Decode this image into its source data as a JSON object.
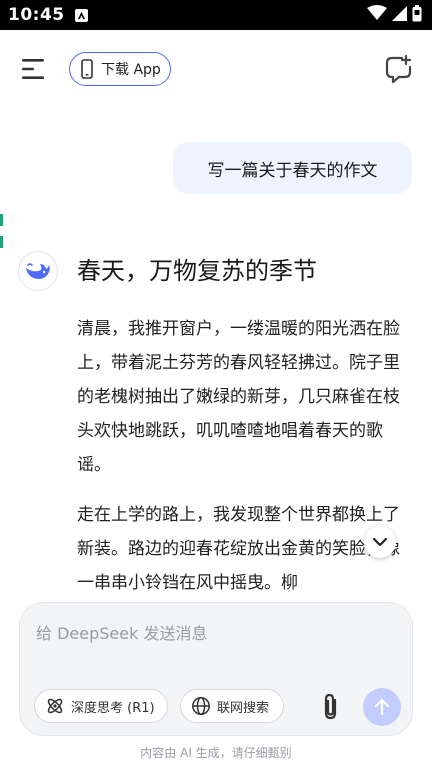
{
  "status_bar": {
    "time": "10:45",
    "notification_icon": "notification-a-icon",
    "icons": [
      "wifi-icon",
      "signal-icon",
      "battery-icon"
    ]
  },
  "header": {
    "menu_icon": "menu-icon",
    "download_label": "下载 App",
    "download_icon": "phone-icon",
    "new_chat_icon": "new-chat-icon"
  },
  "conversation": {
    "user_message": "写一篇关于春天的作文",
    "assistant": {
      "avatar_icon": "deepseek-whale-icon",
      "title": "春天，万物复苏的季节",
      "paragraphs": [
        "清晨，我推开窗户，一缕温暖的阳光洒在脸上，带着泥土芬芳的春风轻轻拂过。院子里的老槐树抽出了嫩绿的新芽，几只麻雀在枝头欢快地跳跃，叽叽喳喳地唱着春天的歌谣。",
        "走在上学的路上，我发现整个世界都换上了新装。路边的迎春花绽放出金黄的笑脸，像一串串小铃铛在风中摇曳。柳"
      ]
    }
  },
  "input": {
    "placeholder": "给 DeepSeek 发送消息",
    "value": "",
    "deep_think_label": "深度思考 (R1)",
    "web_search_label": "联网搜索",
    "attach_icon": "paperclip-icon",
    "send_icon": "arrow-up-icon"
  },
  "footer_note": "内容由 AI 生成，请仔细甄别",
  "colors": {
    "accent": "#4d6bfe",
    "user_bubble": "#eef4ff",
    "send_disabled": "#c3cdfd"
  }
}
